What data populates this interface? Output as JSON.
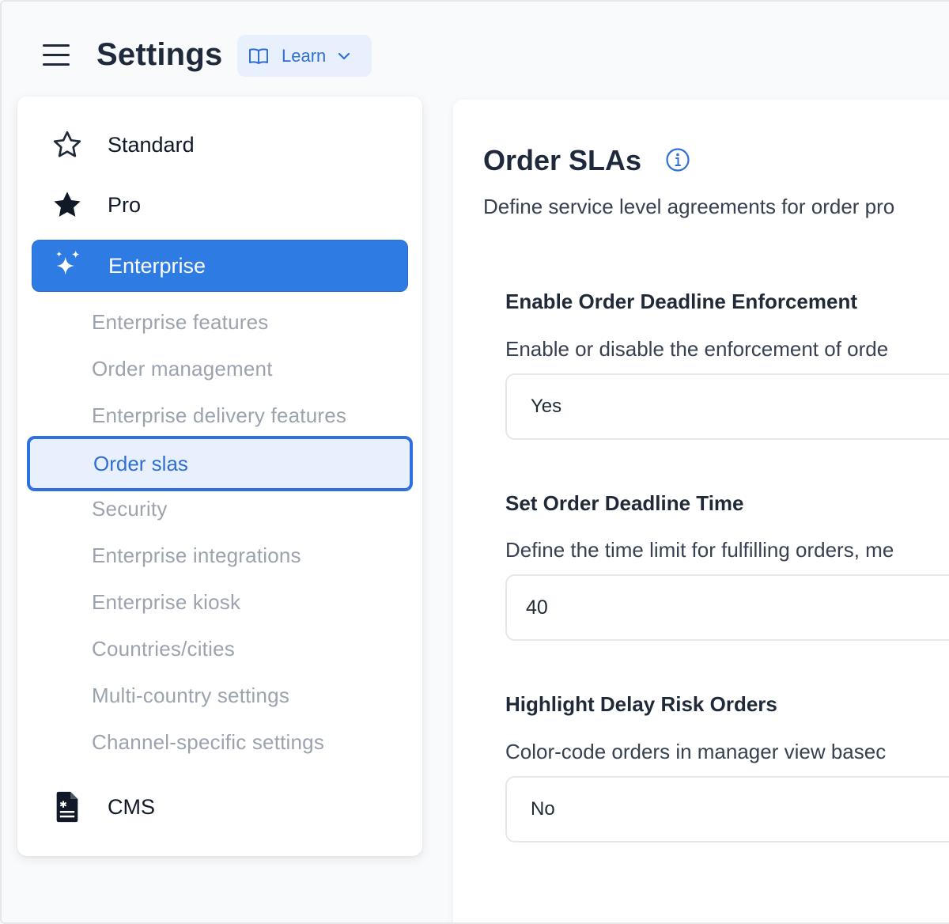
{
  "header": {
    "title": "Settings",
    "learn_label": "Learn"
  },
  "sidebar": {
    "top_items": [
      {
        "label": "Standard",
        "icon": "star-outline-icon"
      },
      {
        "label": "Pro",
        "icon": "star-filled-icon"
      },
      {
        "label": "Enterprise",
        "icon": "sparkles-icon",
        "active": true
      }
    ],
    "sub_items": [
      {
        "label": "Enterprise features"
      },
      {
        "label": "Order management"
      },
      {
        "label": "Enterprise delivery features"
      },
      {
        "label": "Order slas",
        "active": true
      },
      {
        "label": "Security"
      },
      {
        "label": "Enterprise integrations"
      },
      {
        "label": "Enterprise kiosk"
      },
      {
        "label": "Countries/cities"
      },
      {
        "label": "Multi-country settings"
      },
      {
        "label": "Channel-specific settings"
      }
    ],
    "bottom_item": {
      "label": "CMS",
      "icon": "document-icon"
    }
  },
  "main": {
    "title": "Order SLAs",
    "description": "Define service level agreements for order pro",
    "fields": [
      {
        "label": "Enable Order Deadline Enforcement",
        "help": "Enable or disable the enforcement of orde",
        "value": "Yes"
      },
      {
        "label": "Set Order Deadline Time",
        "help": "Define the time limit for fulfilling orders, me",
        "value": "40"
      },
      {
        "label": "Highlight Delay Risk Orders",
        "help": "Color-code orders in manager view basec",
        "value": "No"
      }
    ]
  },
  "colors": {
    "accent": "#2f7be4",
    "accent_light": "#e8f0fd",
    "muted_text": "#9ca3af"
  }
}
